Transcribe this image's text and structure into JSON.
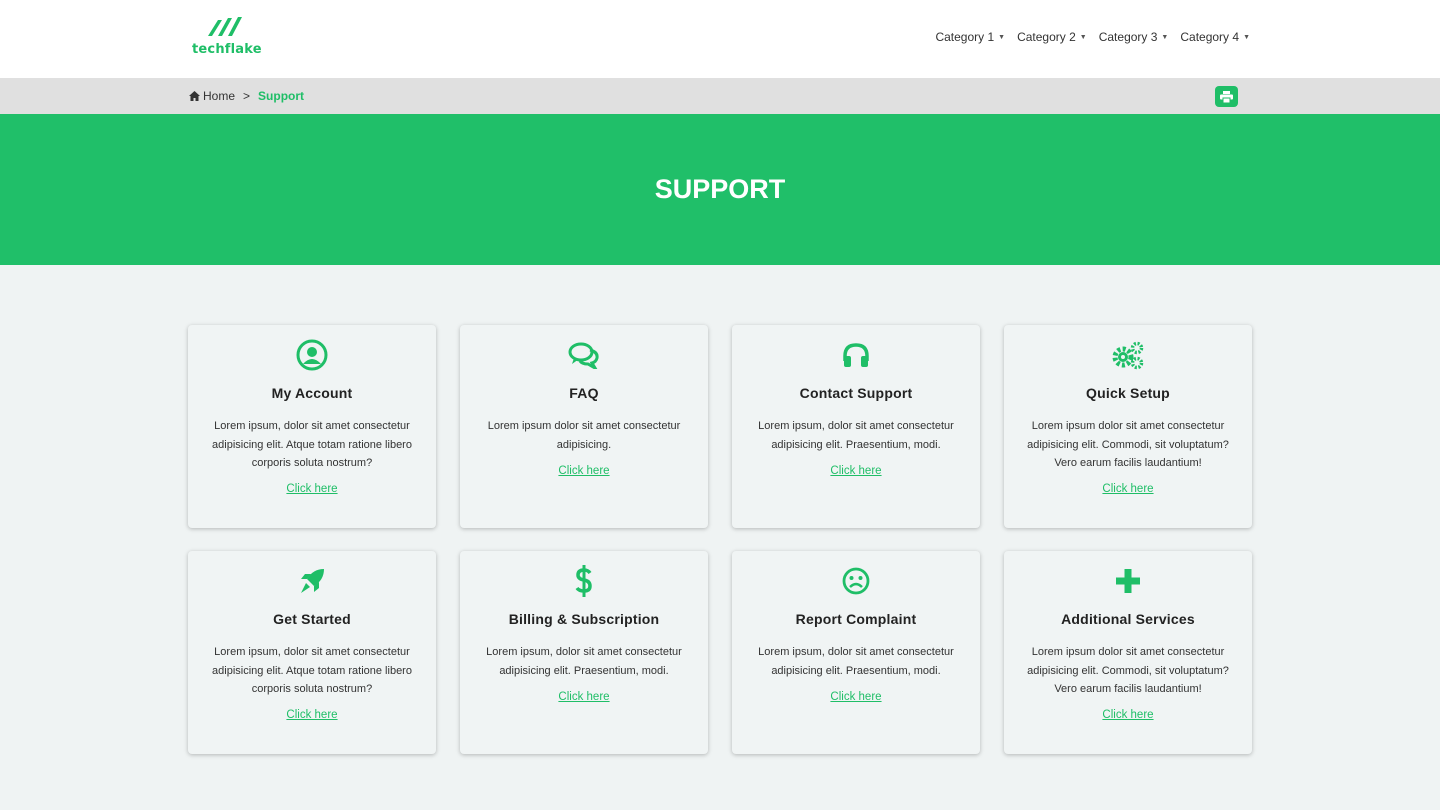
{
  "header": {
    "logo_text": "techflake",
    "nav": [
      {
        "label": "Category 1"
      },
      {
        "label": "Category 2"
      },
      {
        "label": "Category 3"
      },
      {
        "label": "Category 4"
      }
    ]
  },
  "breadcrumb": {
    "home": "Home",
    "separator": ">",
    "current": "Support"
  },
  "hero": {
    "title": "SUPPORT"
  },
  "colors": {
    "accent": "#1fbe67",
    "hero_bg": "#20bf69",
    "page_bg": "#eff3f3"
  },
  "cards": [
    {
      "icon": "user-circle-icon",
      "title": "My Account",
      "desc": "Lorem ipsum, dolor sit amet consectetur adipisicing elit. Atque totam ratione libero corporis soluta nostrum?",
      "link": "Click here"
    },
    {
      "icon": "chat-bubbles-icon",
      "title": "FAQ",
      "desc": "Lorem ipsum dolor sit amet consectetur adipisicing.",
      "link": "Click here"
    },
    {
      "icon": "headphones-icon",
      "title": "Contact Support",
      "desc": "Lorem ipsum, dolor sit amet consectetur adipisicing elit. Praesentium, modi.",
      "link": "Click here"
    },
    {
      "icon": "gears-icon",
      "title": "Quick Setup",
      "desc": "Lorem ipsum dolor sit amet consectetur adipisicing elit. Commodi, sit voluptatum? Vero earum facilis laudantium!",
      "link": "Click here"
    },
    {
      "icon": "rocket-icon",
      "title": "Get Started",
      "desc": "Lorem ipsum, dolor sit amet consectetur adipisicing elit. Atque totam ratione libero corporis soluta nostrum?",
      "link": "Click here"
    },
    {
      "icon": "dollar-icon",
      "title": "Billing & Subscription",
      "desc": "Lorem ipsum, dolor sit amet consectetur adipisicing elit. Praesentium, modi.",
      "link": "Click here"
    },
    {
      "icon": "frown-icon",
      "title": "Report Complaint",
      "desc": "Lorem ipsum, dolor sit amet consectetur adipisicing elit. Praesentium, modi.",
      "link": "Click here"
    },
    {
      "icon": "plus-icon",
      "title": "Additional Services",
      "desc": "Lorem ipsum dolor sit amet consectetur adipisicing elit. Commodi, sit voluptatum? Vero earum facilis laudantium!",
      "link": "Click here"
    }
  ]
}
